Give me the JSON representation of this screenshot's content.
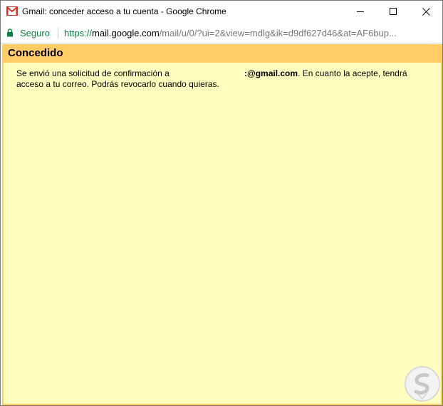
{
  "window": {
    "title": "Gmail: conceder acceso a tu cuenta - Google Chrome"
  },
  "addressbar": {
    "security_label": "Seguro",
    "url_scheme": "https://",
    "url_host": "mail.google.com",
    "url_path": "/mail/u/0/?ui=2&view=mdlg&ik=d9df627d46&at=AF6bup..."
  },
  "panel": {
    "title": "Concedido",
    "message_part1": "Se envió una solicitud de confirmación a",
    "email_fragment": ":@gmail.com",
    "message_part2": ". En cuanto la acepte, tendrá acceso a tu correo. Podrás revocarlo cuando quieras."
  },
  "colors": {
    "header_bg": "#ffcc66",
    "panel_bg": "#fffebe",
    "secure_green": "#0b8043",
    "gmail_red": "#d93025"
  },
  "icons": {
    "app": "gmail-icon",
    "lock": "lock-icon",
    "minimize": "minimize-icon",
    "maximize": "maximize-icon",
    "close": "close-icon",
    "watermark": "logo-watermark"
  }
}
